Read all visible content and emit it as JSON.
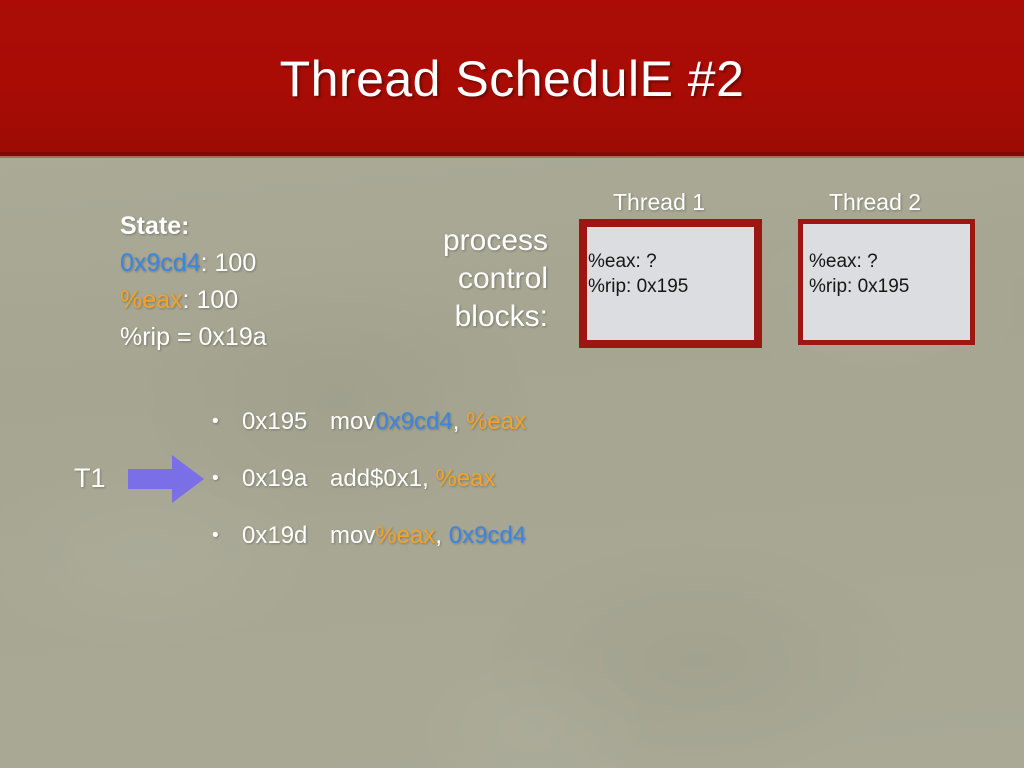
{
  "slide": {
    "title": "Thread SchedulE #2",
    "colors": {
      "band_red": "#a80c05",
      "background": "#a6a693",
      "accent_blue": "#3c86e2",
      "accent_orange": "#f3a227",
      "box_border_red": "#9c1712",
      "box_fill": "#dcdde0",
      "arrow_purple": "#7b6fe8"
    }
  },
  "state": {
    "heading": "State:",
    "lines": [
      {
        "key": "0x9cd4",
        "key_color": "blue",
        "sep": ": ",
        "value": "100"
      },
      {
        "key": "%eax",
        "key_color": "orange",
        "sep": ": ",
        "value": "100"
      },
      {
        "key": "%rip",
        "key_color": "white",
        "sep": " = ",
        "value": "0x19a"
      }
    ]
  },
  "pcb": {
    "label_line1": "process",
    "label_line2": "control",
    "label_line3": "blocks:"
  },
  "threads": [
    {
      "label": "Thread 1",
      "eax_line": "%eax: ?",
      "rip_line": "%rip: 0x195"
    },
    {
      "label": "Thread 2",
      "eax_line": "%eax: ?",
      "rip_line": "%rip: 0x195"
    }
  ],
  "marker": {
    "label": "T1",
    "arrow_icon": "right-arrow-icon"
  },
  "instructions": [
    {
      "bullet": "•",
      "address": "0x195",
      "mnemonic": "mov ",
      "operand1": "0x9cd4",
      "operand1_color": "blue",
      "comma": ", ",
      "operand2": "%eax",
      "operand2_color": "orange"
    },
    {
      "bullet": "•",
      "address": "0x19a",
      "mnemonic": "add ",
      "operand1": "$0x1",
      "operand1_color": "white",
      "comma": ", ",
      "operand2": "%eax",
      "operand2_color": "orange"
    },
    {
      "bullet": "•",
      "address": "0x19d",
      "mnemonic": "mov ",
      "operand1": "%eax",
      "operand1_color": "orange",
      "comma": ", ",
      "operand2": "0x9cd4",
      "operand2_color": "blue"
    }
  ]
}
